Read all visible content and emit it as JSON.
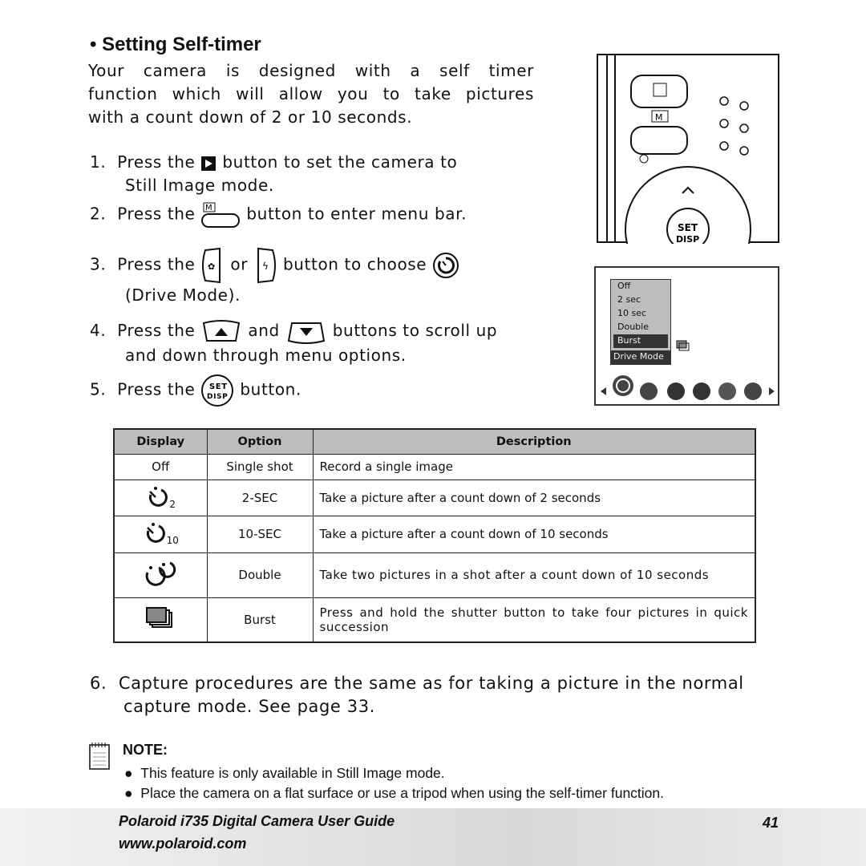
{
  "title": "• Setting Self-timer",
  "intro": [
    "Your camera is designed with a self timer",
    "function which will allow you to take pictures",
    "with a count down of 2 or 10 seconds."
  ],
  "steps": [
    {
      "num": "1.",
      "a": "Press the",
      "b": "button to set the camera to",
      "c": "Still Image mode."
    },
    {
      "num": "2.",
      "a": "Press the",
      "b": "button to enter menu bar."
    },
    {
      "num": "3.",
      "a": "Press the",
      "or": "or",
      "b": "button to choose",
      "c": "(Drive Mode)."
    },
    {
      "num": "4.",
      "a": "Press the",
      "and": "and",
      "b": "buttons to scroll up",
      "c": "and down through menu options."
    },
    {
      "num": "5.",
      "a": "Press the",
      "b": "button."
    }
  ],
  "lcd": {
    "options": [
      "Off",
      "2 sec",
      "10 sec",
      "Double",
      "Burst"
    ],
    "selected": "Burst",
    "label": "Drive Mode"
  },
  "camera": {
    "m_label": "M",
    "set": "SET",
    "disp": "DISP"
  },
  "table": {
    "headers": [
      "Display",
      "Option",
      "Description"
    ],
    "rows": [
      {
        "display": "Off",
        "option": "Single shot",
        "desc": "Record a single image"
      },
      {
        "display_icon": "self-timer-2-icon",
        "sub": "2",
        "option": "2-SEC",
        "desc": "Take a picture after a count down of 2 seconds"
      },
      {
        "display_icon": "self-timer-10-icon",
        "sub": "10",
        "option": "10-SEC",
        "desc": "Take a picture after a count down of 10 seconds"
      },
      {
        "display_icon": "double-timer-icon",
        "option": "Double",
        "desc": "Take two pictures in a shot after a count down of 10 seconds"
      },
      {
        "display_icon": "burst-icon",
        "option": "Burst",
        "desc": "Press and hold the shutter button to take four pictures in quick succession"
      }
    ]
  },
  "step6": {
    "num": "6.",
    "l1": "Capture procedures are the same as for taking a picture in the normal",
    "l2": "capture mode. See page 33."
  },
  "note": {
    "label": "NOTE:",
    "bullets": [
      "This feature is only available in Still Image mode.",
      "Place the camera on a flat surface or use a tripod when using the self-timer function."
    ]
  },
  "footer": {
    "guide": "Polaroid i735 Digital Camera User Guide",
    "page": "41",
    "url": "www.polaroid.com"
  }
}
